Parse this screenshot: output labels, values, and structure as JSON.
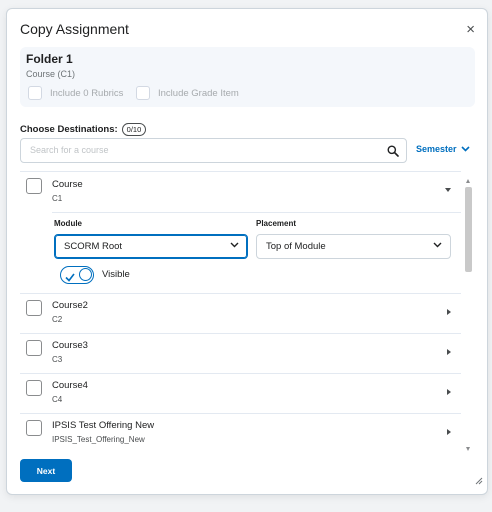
{
  "dialog": {
    "title": "Copy Assignment",
    "close_icon": "close-icon",
    "close_glyph": "×"
  },
  "folder": {
    "name": "Folder 1",
    "course": "Course (C1)",
    "include_rubrics_label": "Include 0 Rubrics",
    "include_grade_label": "Include Grade Item"
  },
  "destinations": {
    "label": "Choose Destinations:",
    "count": "0/10",
    "search_placeholder": "Search for a course",
    "filter_label": "Semester"
  },
  "courses": [
    {
      "name": "Course",
      "code": "C1",
      "expanded": true,
      "module_label": "Module",
      "module_value": "SCORM Root",
      "placement_label": "Placement",
      "placement_value": "Top of Module",
      "visible_label": "Visible",
      "visible": true
    },
    {
      "name": "Course2",
      "code": "C2",
      "expanded": false
    },
    {
      "name": "Course3",
      "code": "C3",
      "expanded": false
    },
    {
      "name": "Course4",
      "code": "C4",
      "expanded": false
    },
    {
      "name": "IPSIS Test Offering New",
      "code": "IPSIS_Test_Offering_New",
      "expanded": false
    }
  ],
  "footer": {
    "next_label": "Next"
  },
  "colors": {
    "accent": "#006fbf",
    "panel": "#f4f7fb",
    "border": "#cdd5dc"
  }
}
